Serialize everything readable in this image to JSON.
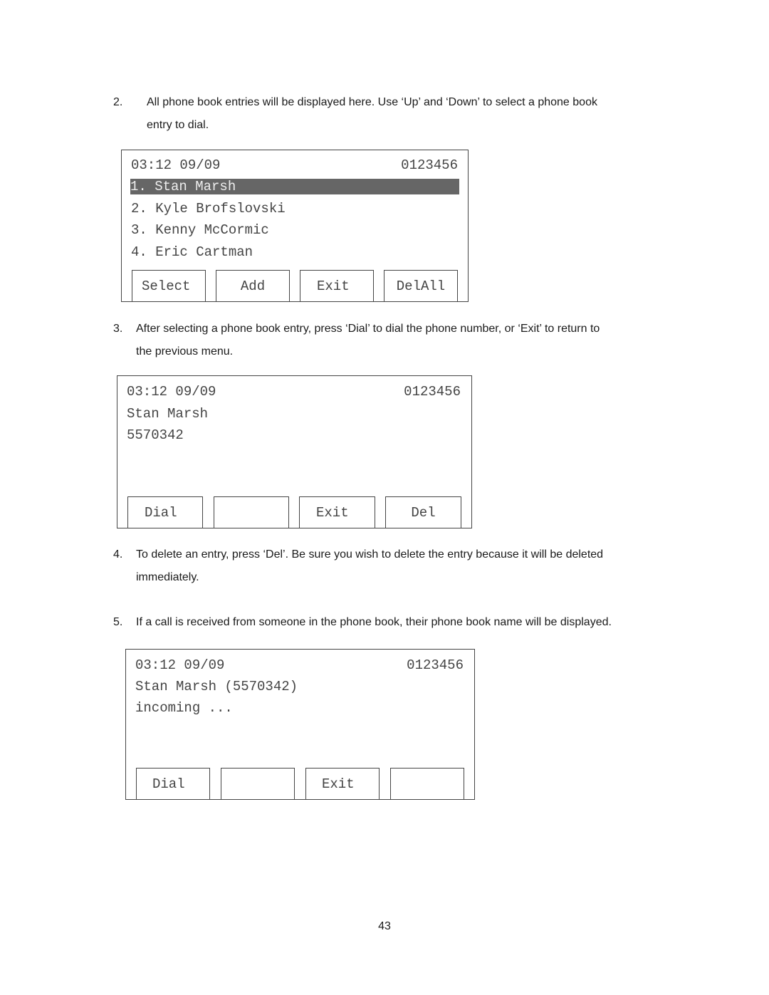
{
  "steps": [
    {
      "number": "2.",
      "text_line1": "All phone book entries will be displayed here.    Use ‘Up’ and ‘Down’ to select a phone book",
      "text_line2": "entry to dial."
    },
    {
      "number": "3.",
      "text_line1": "After selecting a phone book entry, press ‘Dial’ to dial the phone number, or ‘Exit’ to return to",
      "text_line2": "the previous menu."
    },
    {
      "number": "4.",
      "text_line1": "To delete an entry, press ‘Del’.    Be sure you wish to delete the entry because it will be deleted",
      "text_line2": "immediately."
    },
    {
      "number": "5.",
      "text_line1": "If a call is received from someone in the phone book, their phone book name will be displayed."
    }
  ],
  "screens": [
    {
      "header_time": "03:12 09/09",
      "header_number": "0123456",
      "lines": [
        "1. Stan Marsh",
        "2. Kyle Brofslovski",
        "3. Kenny McCormic",
        "4. Eric Cartman"
      ],
      "selected_index": 0,
      "softkeys": [
        "Select",
        "Add",
        "Exit",
        "DelAll"
      ]
    },
    {
      "header_time": "03:12 09/09",
      "header_number": "0123456",
      "lines": [
        "Stan Marsh",
        "5570342"
      ],
      "softkeys": [
        "Dial",
        "",
        "Exit",
        "Del"
      ]
    },
    {
      "header_time": "03:12 09/09",
      "header_number": "0123456",
      "lines": [
        "Stan Marsh (5570342)",
        "incoming ..."
      ],
      "softkeys": [
        "Dial",
        "",
        "Exit",
        ""
      ]
    }
  ],
  "page_number": "43"
}
